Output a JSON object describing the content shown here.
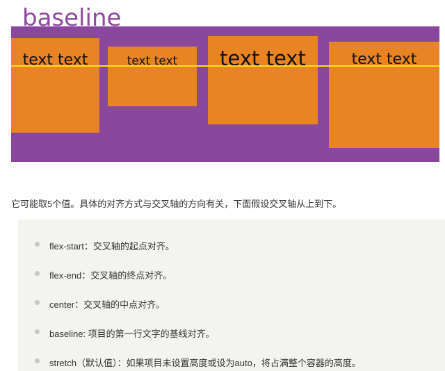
{
  "demo": {
    "title": "baseline",
    "items": [
      "text text",
      "text text",
      "text text",
      "text text"
    ],
    "colors": {
      "container": "#89479e",
      "item": "#e98424",
      "baseline_line": "#f7e017",
      "title": "#8e4a9e"
    }
  },
  "description": "它可能取5个值。具体的对齐方式与交叉轴的方向有关，下面假设交叉轴从上到下。",
  "options": [
    "flex-start：交叉轴的起点对齐。",
    "flex-end：交叉轴的终点对齐。",
    "center：交叉轴的中点对齐。",
    "baseline: 项目的第一行文字的基线对齐。",
    "stretch（默认值）：如果项目未设置高度或设为auto，将占满整个容器的高度。"
  ],
  "options_panel_color": "#f3f4ef",
  "bullet_icon": "dot-bullet-icon"
}
